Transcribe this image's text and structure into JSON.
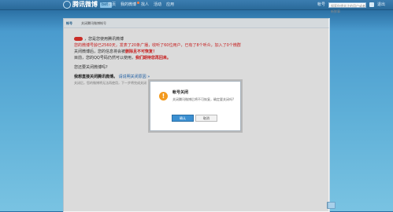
{
  "header": {
    "logo_text": "腾讯微博",
    "logo_badge": "beta",
    "nav": [
      "首页",
      "我的微博",
      "找人",
      "活动",
      "应用"
    ],
    "search_placeholder": "搜索你想关注的用户或者新鲜事",
    "right_links": [
      "帐号",
      "退出"
    ]
  },
  "panel": {
    "tag": "帐号",
    "title": "关闭腾讯微博帐号"
  },
  "content": {
    "line1": "，您是您使用腾讯微博",
    "line2": "您的微博号龄已2560天，发表了20条广播，收听了60位用户，已有了8个听众，加入了0个微群",
    "line3_a": "关闭微博后，您的信息将会被",
    "line3_b": "删除且不可恢复！",
    "line4_a": "目前，您的QQ号码仍然可以使用，",
    "line4_b": "我们期待您再回来。",
    "line5": "您还要关闭微博吗?",
    "section_heading": "我想直接关闭腾讯微博。",
    "section_link": "请说明关闭原因 »",
    "small_text": "关闭后，您的微博将无法再使用，下一步将完成关闭"
  },
  "dialog": {
    "icon": "warning-icon",
    "title": "帐号关闭",
    "message": "关闭腾讯微博后将不可恢复，确定要关闭吗?",
    "ok_label": "确认",
    "cancel_label": "取消"
  },
  "colors": {
    "accent": "#3b8fd1",
    "warning": "#f39a1e",
    "highlight": "#dd2222"
  }
}
